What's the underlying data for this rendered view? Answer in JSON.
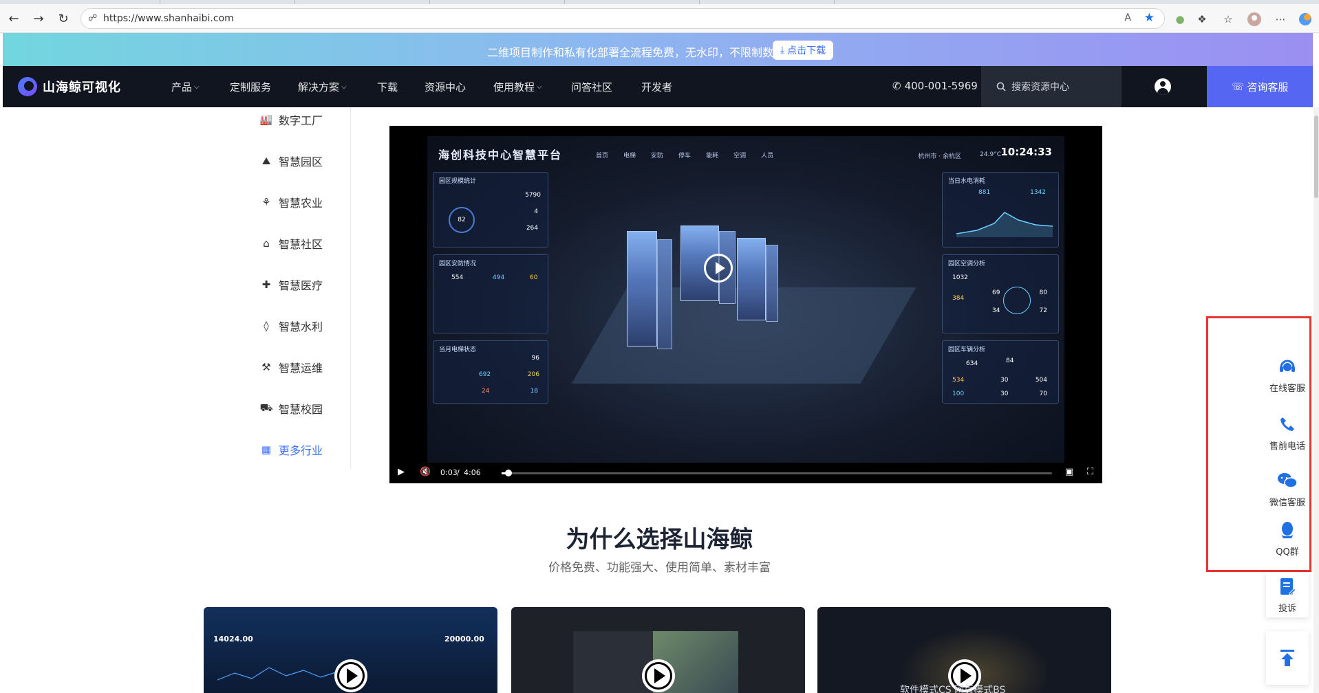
{
  "browser": {
    "url": "https://www.shanhaibi.com",
    "read_aloud_label": "A"
  },
  "promo": {
    "text": "二维项目制作和私有化部署全流程免费，无水印，不限制数量",
    "button_label": "点击下载"
  },
  "nav": {
    "logo_text": "山海鲸可视化",
    "items": [
      {
        "label": "产品",
        "dropdown": true
      },
      {
        "label": "定制服务",
        "dropdown": false
      },
      {
        "label": "解决方案",
        "dropdown": true
      },
      {
        "label": "下载",
        "dropdown": false
      },
      {
        "label": "资源中心",
        "dropdown": false
      },
      {
        "label": "使用教程",
        "dropdown": true
      },
      {
        "label": "问答社区",
        "dropdown": false
      },
      {
        "label": "开发者",
        "dropdown": false
      }
    ],
    "phone": "400-001-5969",
    "search_placeholder": "搜索资源中心",
    "consult_label": "咨询客服"
  },
  "industries": [
    {
      "label": "数字工厂",
      "icon": "factory-icon"
    },
    {
      "label": "智慧园区",
      "icon": "park-icon"
    },
    {
      "label": "智慧农业",
      "icon": "sprout-icon"
    },
    {
      "label": "智慧社区",
      "icon": "community-icon"
    },
    {
      "label": "智慧医疗",
      "icon": "medical-icon"
    },
    {
      "label": "智慧水利",
      "icon": "water-drop-icon"
    },
    {
      "label": "智慧运维",
      "icon": "toolbox-icon"
    },
    {
      "label": "智慧校园",
      "icon": "bus-icon"
    },
    {
      "label": "更多行业",
      "icon": "grid-icon"
    }
  ],
  "video": {
    "dashboard_title": "海创科技中心智慧平台",
    "dashboard_tabs": [
      "首页",
      "电梯",
      "安防",
      "停车",
      "能耗",
      "空调",
      "人员"
    ],
    "clock": "10:24:33",
    "location": "杭州市 · 余杭区",
    "temperature": "24.9°C",
    "panels": {
      "park_stats": "园区规模统计",
      "park_stats_values": [
        "5790",
        "4",
        "264"
      ],
      "gauge": "82",
      "security": "园区安防情况",
      "security_values": [
        "554",
        "494",
        "60"
      ],
      "elevator": "当月电梯状态",
      "elevator_values": [
        "96",
        "692",
        "206",
        "24",
        "18"
      ],
      "power": "当日水电消耗",
      "power_values": [
        "881",
        "1342"
      ],
      "aircon": "园区空调分析",
      "aircon_values": [
        "1032",
        "69",
        "384",
        "80",
        "34",
        "72"
      ],
      "parking": "园区车辆分析",
      "parking_values": [
        "634",
        "84",
        "534",
        "30",
        "504",
        "100",
        "30",
        "70"
      ]
    },
    "current_time": "0:03",
    "duration": "4:06",
    "progress_fraction": 0.012
  },
  "why": {
    "title": "为什么选择山海鲸",
    "subtitle": "价格免费、功能强大、使用简单、素材丰富"
  },
  "cards": [
    {
      "name": "card-sales-dashboard",
      "caption": "",
      "values": [
        "14024.00",
        "20000.00"
      ]
    },
    {
      "name": "card-editor",
      "caption": ""
    },
    {
      "name": "card-modes",
      "caption": "软件模式CS 网页模式BS"
    }
  ],
  "float_toolbar": [
    {
      "label": "在线客服",
      "icon": "headset-icon"
    },
    {
      "label": "售前电话",
      "icon": "phone-icon"
    },
    {
      "label": "微信客服",
      "icon": "wechat-icon"
    },
    {
      "label": "QQ群",
      "icon": "qq-icon"
    },
    {
      "label": "投诉",
      "icon": "complaint-icon"
    },
    {
      "label": "",
      "icon": "back-to-top-icon"
    }
  ],
  "colors": {
    "accent": "#3a6ff7",
    "nav_bg": "#101520",
    "consult_bg": "#5566f2",
    "highlight_box": "#e8352f"
  }
}
